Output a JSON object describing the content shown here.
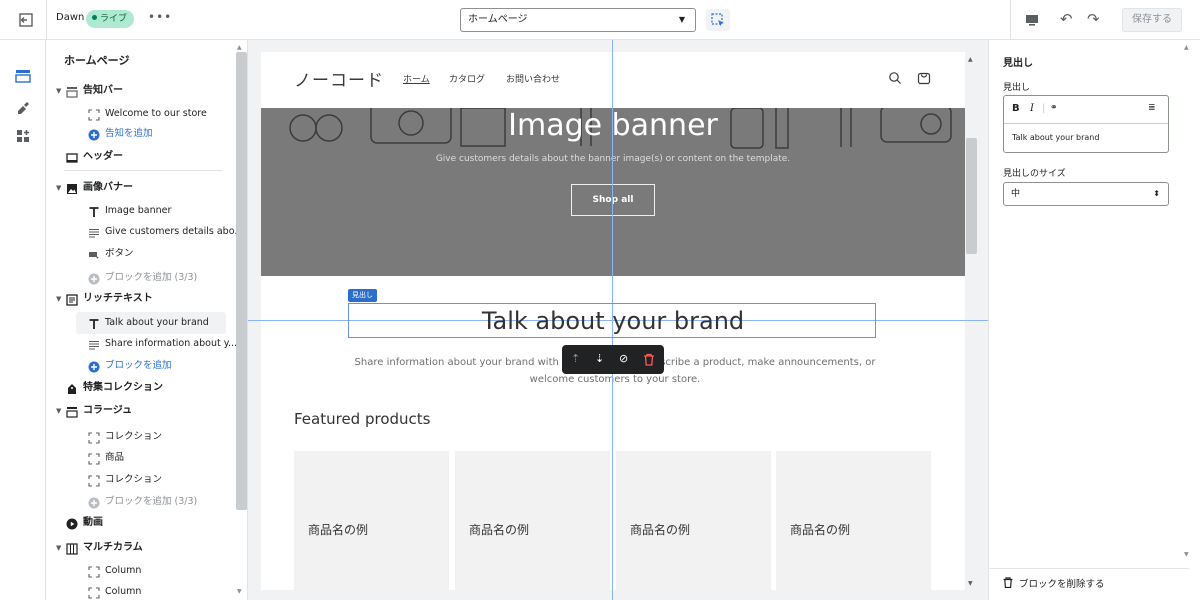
{
  "topbar": {
    "theme_name": "Dawn",
    "live_badge": "ライブ",
    "more_label": "•••",
    "page_select": "ホームページ",
    "undo_glyph": "↶",
    "redo_glyph": "↷",
    "save_label": "保存する"
  },
  "sidebar": {
    "title": "ホームページ",
    "items": [
      {
        "label": "告知バー",
        "kind": "section",
        "icon": "announcement-bar-icon",
        "expanded": true
      },
      {
        "label": "Welcome to our store",
        "kind": "block",
        "icon": "block-icon"
      },
      {
        "label": "告知を追加",
        "kind": "add",
        "icon": "plus-circle-icon"
      },
      {
        "label": "ヘッダー",
        "kind": "section-plain",
        "icon": "header-icon"
      },
      {
        "label": "画像バナー",
        "kind": "section",
        "icon": "image-icon",
        "expanded": true
      },
      {
        "label": "Image banner",
        "kind": "block",
        "icon": "text-icon"
      },
      {
        "label": "Give customers details abo...",
        "kind": "block",
        "icon": "paragraph-icon"
      },
      {
        "label": "ボタン",
        "kind": "block",
        "icon": "button-icon"
      },
      {
        "label": "ブロックを追加 (3/3)",
        "kind": "add-disabled",
        "icon": "plus-circle-icon"
      },
      {
        "label": "リッチテキスト",
        "kind": "section",
        "icon": "richtext-icon",
        "expanded": true
      },
      {
        "label": "Talk about your brand",
        "kind": "block-selected",
        "icon": "text-icon"
      },
      {
        "label": "Share information about y...",
        "kind": "block",
        "icon": "paragraph-icon"
      },
      {
        "label": "ブロックを追加",
        "kind": "add",
        "icon": "plus-circle-icon"
      },
      {
        "label": "特集コレクション",
        "kind": "section-plain",
        "icon": "collection-icon"
      },
      {
        "label": "コラージュ",
        "kind": "section",
        "icon": "collage-icon",
        "expanded": true
      },
      {
        "label": "コレクション",
        "kind": "block",
        "icon": "block-icon"
      },
      {
        "label": "商品",
        "kind": "block",
        "icon": "block-icon"
      },
      {
        "label": "コレクション",
        "kind": "block",
        "icon": "block-icon"
      },
      {
        "label": "ブロックを追加 (3/3)",
        "kind": "add-disabled",
        "icon": "plus-circle-icon"
      },
      {
        "label": "動画",
        "kind": "section-plain",
        "icon": "video-icon"
      },
      {
        "label": "マルチカラム",
        "kind": "section",
        "icon": "multicolumn-icon",
        "expanded": true
      },
      {
        "label": "Column",
        "kind": "block",
        "icon": "block-icon"
      },
      {
        "label": "Column",
        "kind": "block",
        "icon": "block-icon"
      }
    ]
  },
  "preview": {
    "logo": "ノーコード",
    "nav": [
      "ホーム",
      "カタログ",
      "お問い合わせ"
    ],
    "banner": {
      "title": "Image banner",
      "subtitle": "Give customers details about the banner image(s) or content on the template.",
      "button": "Shop all"
    },
    "selection_tag": "見出し",
    "heading": "Talk about your brand",
    "richtext_line1": "Share information about your brand with your customers. Describe a product, make announcements, or",
    "richtext_line2": "welcome customers to your store.",
    "featured_title": "Featured products",
    "products": [
      "商品名の例",
      "商品名の例",
      "商品名の例",
      "商品名の例"
    ]
  },
  "right_panel": {
    "title": "見出し",
    "heading_label": "見出し",
    "heading_value": "Talk about your brand",
    "size_label": "見出しのサイズ",
    "size_value": "中",
    "delete_label": "ブロックを削除する"
  },
  "colors": {
    "accent": "#2c6ecb",
    "live_badge_bg": "#aee9d1",
    "banner_bg": "#7a7a7a"
  }
}
